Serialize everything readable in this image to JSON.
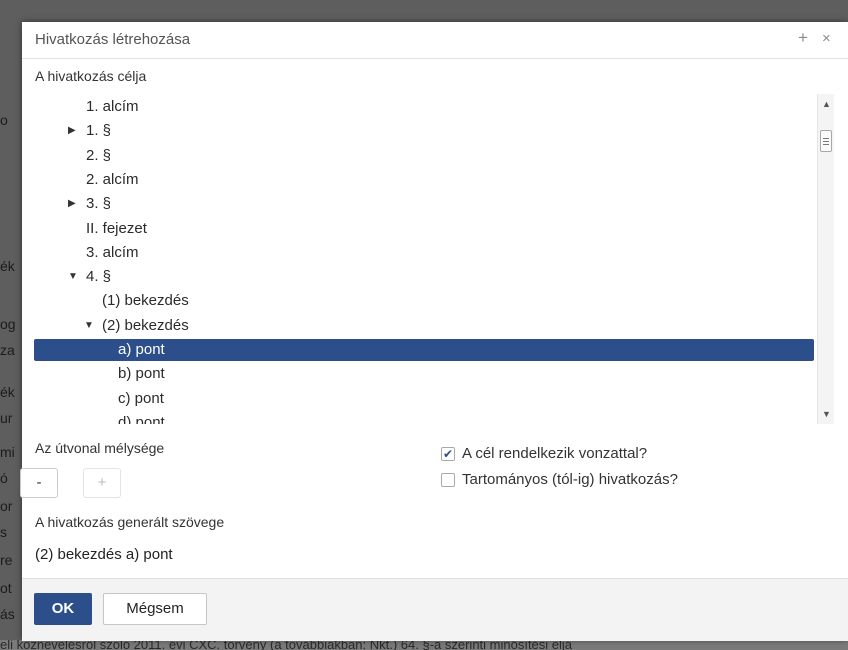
{
  "background": {
    "bottom_text": "eli köznevelésről szóló 2011. évi CXC. törvény (a továbbiakban: Nkt.) 64. §-a szerinti minősítési eljá",
    "left_fragments": [
      "o",
      "ék",
      "",
      "og",
      "za",
      "ék",
      "ur",
      "mi",
      "ó",
      "or",
      "s",
      "re",
      "ot",
      "ás"
    ]
  },
  "dialog": {
    "title": "Hivatkozás létrehozása",
    "target_label": "A hivatkozás célja",
    "tree": [
      {
        "label": "1. alcím",
        "toggle": ""
      },
      {
        "label": "1. §",
        "toggle": "▶"
      },
      {
        "label": "2. §",
        "toggle": ""
      },
      {
        "label": "2. alcím",
        "toggle": ""
      },
      {
        "label": "3. §",
        "toggle": "▶"
      },
      {
        "label": "II. fejezet",
        "toggle": ""
      },
      {
        "label": "3. alcím",
        "toggle": ""
      },
      {
        "label": "4. §",
        "toggle": "▼"
      },
      {
        "label": "(1) bekezdés",
        "toggle": ""
      },
      {
        "label": "(2) bekezdés",
        "toggle": "▼"
      },
      {
        "label": "a) pont",
        "toggle": "",
        "selected": true
      },
      {
        "label": "b) pont",
        "toggle": ""
      },
      {
        "label": "c) pont",
        "toggle": ""
      },
      {
        "label": "d) pont",
        "toggle": ""
      }
    ],
    "depth_label": "Az útvonal mélysége",
    "minus_label": "-",
    "plus_label": "+",
    "checkbox_attach": {
      "label": "A cél rendelkezik vonzattal?",
      "checked": true
    },
    "checkbox_range": {
      "label": "Tartományos (tól-ig) hivatkozás?",
      "checked": false
    },
    "generated_label": "A hivatkozás generált szövege",
    "generated_text": "(2) bekezdés a) pont",
    "ok_label": "OK",
    "cancel_label": "Mégsem",
    "check_mark": "✔"
  },
  "icons": {
    "expand": "plus-icon",
    "close": "close-icon"
  },
  "colors": {
    "accent": "#2c4f8c",
    "footer_bg": "#f3f3f3"
  }
}
